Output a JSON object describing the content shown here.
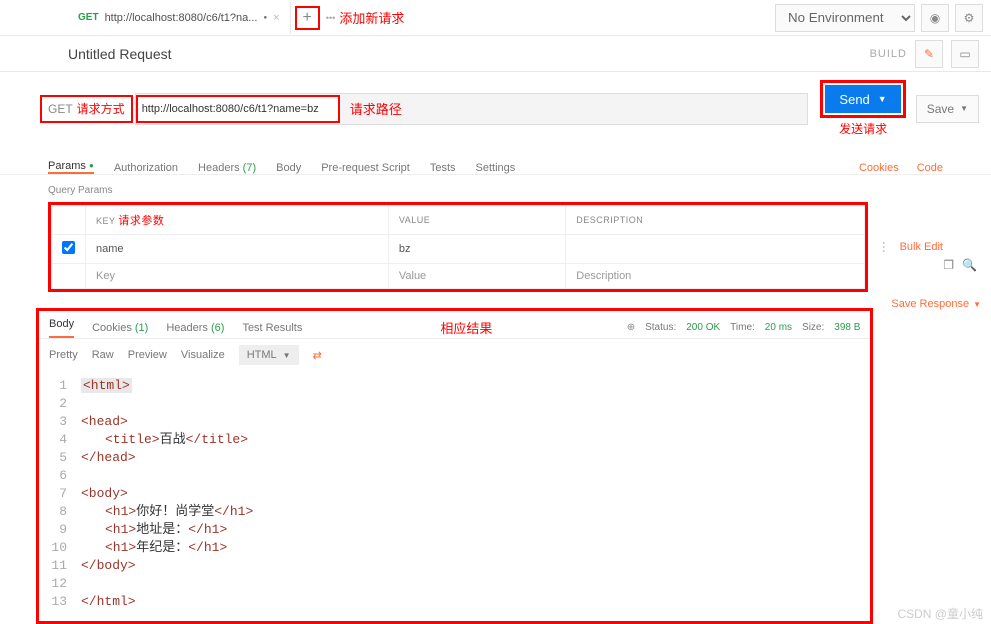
{
  "top": {
    "tabMethod": "GET",
    "tabUrl": "http://localhost:8080/c6/t1?na...",
    "add": "+",
    "ellipsis": "•••",
    "addAnno": "添加新请求",
    "envPlaceholder": "No Environment"
  },
  "title": {
    "text": "Untitled Request",
    "build": "BUILD"
  },
  "req": {
    "method": "GET",
    "methodAnno": "请求方式",
    "url": "http://localhost:8080/c6/t1?name=bz",
    "urlAnno": "请求路径",
    "send": "Send",
    "save": "Save",
    "sendAnno": "发送请求"
  },
  "tabs": {
    "params": "Params",
    "auth": "Authorization",
    "headers": "Headers",
    "headersCount": "(7)",
    "body": "Body",
    "prereq": "Pre-request Script",
    "tests": "Tests",
    "settings": "Settings",
    "cookies": "Cookies",
    "code": "Code"
  },
  "qp": {
    "label": "Query Params",
    "keyHead": "KEY",
    "valHead": "VALUE",
    "descHead": "DESCRIPTION",
    "anno": "请求参数",
    "rows": [
      {
        "key": "name",
        "value": "bz",
        "desc": ""
      },
      {
        "key": "Key",
        "value": "Value",
        "desc": "Description"
      }
    ],
    "bulk": "Bulk Edit"
  },
  "resp": {
    "body": "Body",
    "cookies": "Cookies",
    "cookiesN": "(1)",
    "headers": "Headers",
    "headersN": "(6)",
    "testresults": "Test Results",
    "anno": "相应结果",
    "statusLabel": "Status:",
    "status": "200 OK",
    "timeLabel": "Time:",
    "time": "20 ms",
    "sizeLabel": "Size:",
    "size": "398 B",
    "saveResp": "Save Response",
    "view": {
      "pretty": "Pretty",
      "raw": "Raw",
      "preview": "Preview",
      "visualize": "Visualize",
      "html": "HTML"
    },
    "content": {
      "title_text": "百战",
      "h1_1": "你好！尚学堂",
      "h1_2": "地址是：",
      "h1_3": "年纪是："
    }
  },
  "watermark": "CSDN @童小纯"
}
